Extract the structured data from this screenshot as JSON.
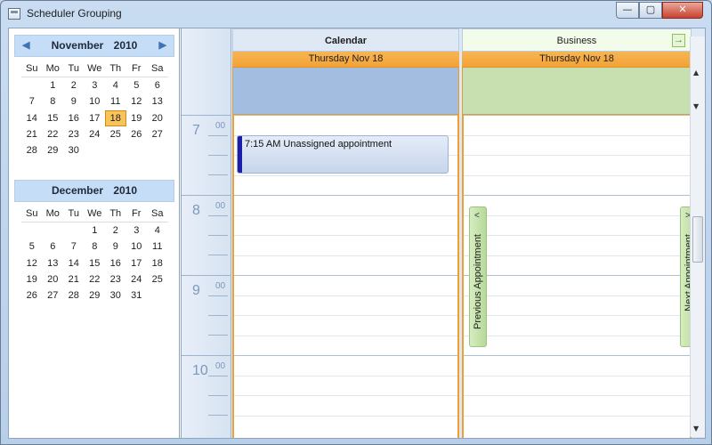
{
  "window": {
    "title": "Scheduler Grouping",
    "minimize_glyph": "—",
    "maximize_glyph": "▢",
    "close_glyph": "✕"
  },
  "calendar": {
    "months": [
      {
        "name": "November",
        "year": "2010",
        "prev_glyph": "◀",
        "next_glyph": "▶",
        "days_of_week": [
          "Su",
          "Mo",
          "Tu",
          "We",
          "Th",
          "Fr",
          "Sa"
        ],
        "cells": [
          "",
          "1",
          "2",
          "3",
          "4",
          "5",
          "6",
          "7",
          "8",
          "9",
          "10",
          "11",
          "12",
          "13",
          "14",
          "15",
          "16",
          "17",
          "18",
          "19",
          "20",
          "21",
          "22",
          "23",
          "24",
          "25",
          "26",
          "27",
          "28",
          "29",
          "30",
          "",
          "",
          "",
          ""
        ],
        "selected_day": "18"
      },
      {
        "name": "December",
        "year": "2010",
        "days_of_week": [
          "Su",
          "Mo",
          "Tu",
          "We",
          "Th",
          "Fr",
          "Sa"
        ],
        "cells": [
          "",
          "",
          "",
          "1",
          "2",
          "3",
          "4",
          "5",
          "6",
          "7",
          "8",
          "9",
          "10",
          "11",
          "12",
          "13",
          "14",
          "15",
          "16",
          "17",
          "18",
          "19",
          "20",
          "21",
          "22",
          "23",
          "24",
          "25",
          "26",
          "27",
          "28",
          "29",
          "30",
          "31",
          ""
        ],
        "selected_day": ""
      }
    ]
  },
  "scheduler": {
    "hours": [
      {
        "hour": "7",
        "minutes": "00"
      },
      {
        "hour": "8",
        "minutes": "00"
      },
      {
        "hour": "9",
        "minutes": "00"
      },
      {
        "hour": "10",
        "minutes": "00"
      }
    ],
    "groups": [
      {
        "name": "Calendar",
        "date": "Thursday Nov 18",
        "header_color": "#dfe9f6",
        "allday_color": "#a3bde0"
      },
      {
        "name": "Business",
        "date": "Thursday Nov 18",
        "header_color": "#f3fbea",
        "allday_color": "#c8e0b0"
      }
    ],
    "appointment": {
      "time": "7:15 AM",
      "subject": "Unassigned appointment",
      "color": "#1d1da8"
    },
    "nav": {
      "previous_label": "Previous Appointment",
      "next_label": "Next Appointment",
      "previous_glyph": "<",
      "next_glyph": ">",
      "goto_glyph": "→"
    }
  }
}
